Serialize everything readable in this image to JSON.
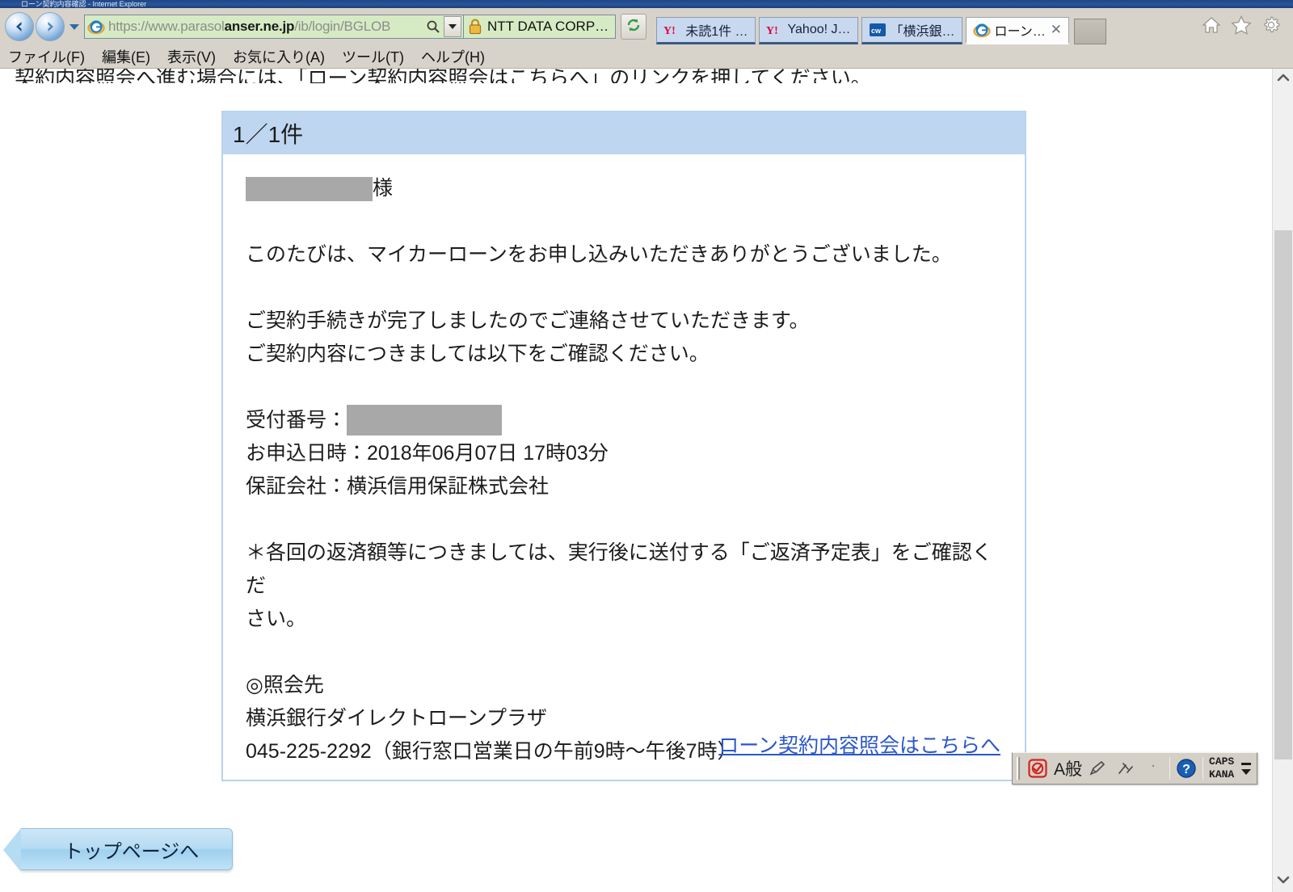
{
  "window": {
    "title_text": "ローン契約内容確認 - Internet Explorer"
  },
  "toolbar": {
    "back_icon": "back-arrow-icon",
    "forward_icon": "forward-arrow-icon",
    "recent_pages_icon": "chevron-down-icon",
    "address": {
      "icon": "ie-favicon-icon",
      "scheme": "https://www.parasol",
      "host": "anser.ne.jp",
      "path": "/ib/login/BGLOB",
      "full": "https://www.parasol.anser.ne.jp/ib/login/BGLOB",
      "search_icon": "search-icon",
      "dropdown_icon": "chevron-down-icon"
    },
    "security_chip": {
      "lock_icon": "lock-icon",
      "label": "NTT DATA CORP…"
    },
    "refresh_icon": "refresh-icon",
    "home_icon": "home-icon",
    "favorites_icon": "star-icon",
    "settings_icon": "gear-icon"
  },
  "tabs": [
    {
      "icon": "yahoo-icon",
      "label": "未読1件 …",
      "active": false,
      "closable": false
    },
    {
      "icon": "yahoo-icon",
      "label": "Yahoo! J…",
      "active": false,
      "closable": false
    },
    {
      "icon": "cw-icon",
      "label": "「横浜銀…",
      "active": false,
      "closable": false
    },
    {
      "icon": "ie-favicon-icon",
      "label": "ローン…",
      "active": true,
      "closable": true,
      "close_label": "✕"
    }
  ],
  "new_tab_button": "new-tab",
  "menu": [
    "ファイル(F)",
    "編集(E)",
    "表示(V)",
    "お気に入り(A)",
    "ツール(T)",
    "ヘルプ(H)"
  ],
  "page": {
    "clipped_top_line": "契約内容照会へ進む場合には、「ローン契約内容照会はこちらへ」のリンクを押してください。",
    "panel": {
      "header": "1／1件",
      "salutation_suffix": "様",
      "salutation_redacted": true,
      "paragraphs": [
        "このたびは、マイカーローンをお申し込みいただきありがとうございました。",
        "ご契約手続きが完了しましたのでご連絡させていただきます。",
        "ご契約内容につきましては以下をご確認ください。"
      ],
      "details": [
        {
          "label": "受付番号：",
          "value": "",
          "redacted": true
        },
        {
          "label": "お申込日時：",
          "value": "2018年06月07日 17時03分",
          "redacted": false
        },
        {
          "label": "保証会社：",
          "value": "横浜信用保証株式会社",
          "redacted": false
        }
      ],
      "note_line1": "＊各回の返済額等につきましては、実行後に送付する「ご返済予定表」をご確認くだ",
      "note_line2": "さい。",
      "contact_heading": "◎照会先",
      "contact_name": "横浜銀行ダイレクトローンプラザ",
      "contact_phone": "045-225-2292（銀行窓口営業日の午前9時～午後7時）",
      "inquiry_link": "ローン契約内容照会はこちらへ"
    },
    "top_page_button": "トップページへ"
  },
  "scrollbar": {
    "up_arrow": "chevron-up-icon",
    "down_arrow": "chevron-down-icon"
  },
  "ime_toolbar": {
    "mode_icon": "ime-mode-icon",
    "input_mode": "A般",
    "conversion_icon": "pen-icon",
    "tool_icon": "tools-icon",
    "help_icon": "help-icon",
    "caps": "CAPS",
    "kana": "KANA",
    "minimize_icon": "minimize-icon",
    "options_icon": "chevron-down-icon"
  },
  "colors": {
    "chrome": "#d7d3cb",
    "address_bg": "#d6ebc4",
    "panel_border": "#b8d3ef",
    "panel_header": "#bed6f0",
    "link": "#2b58c8",
    "redaction": "#a8a8a8",
    "button_blue": "#b4dbf3"
  }
}
